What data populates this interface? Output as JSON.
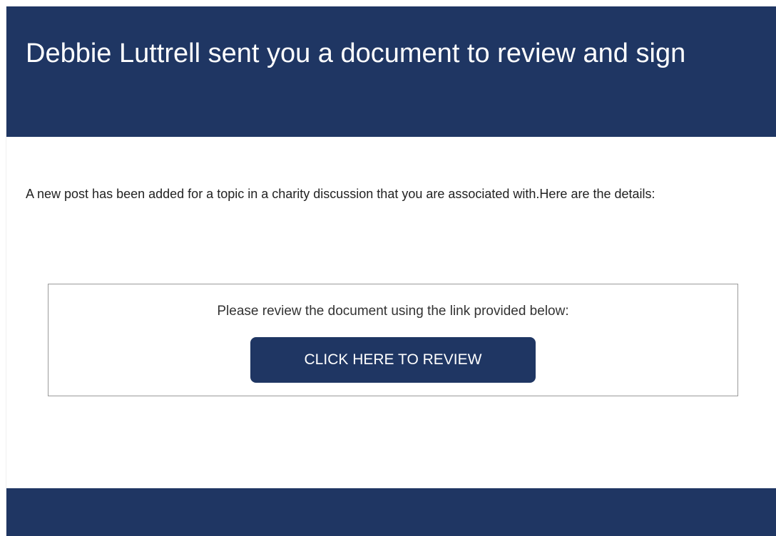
{
  "header": {
    "title": "Debbie Luttrell sent you a document to review and sign"
  },
  "body": {
    "intro": "A new post has been added for a topic in a charity discussion that you are associated with.Here are the details:"
  },
  "card": {
    "instruction": "Please review the document using the link provided below:",
    "button_label": "CLICK HERE TO REVIEW"
  },
  "colors": {
    "brand": "#1f3663",
    "background": "#ffffff",
    "border": "#9a9a9a"
  }
}
